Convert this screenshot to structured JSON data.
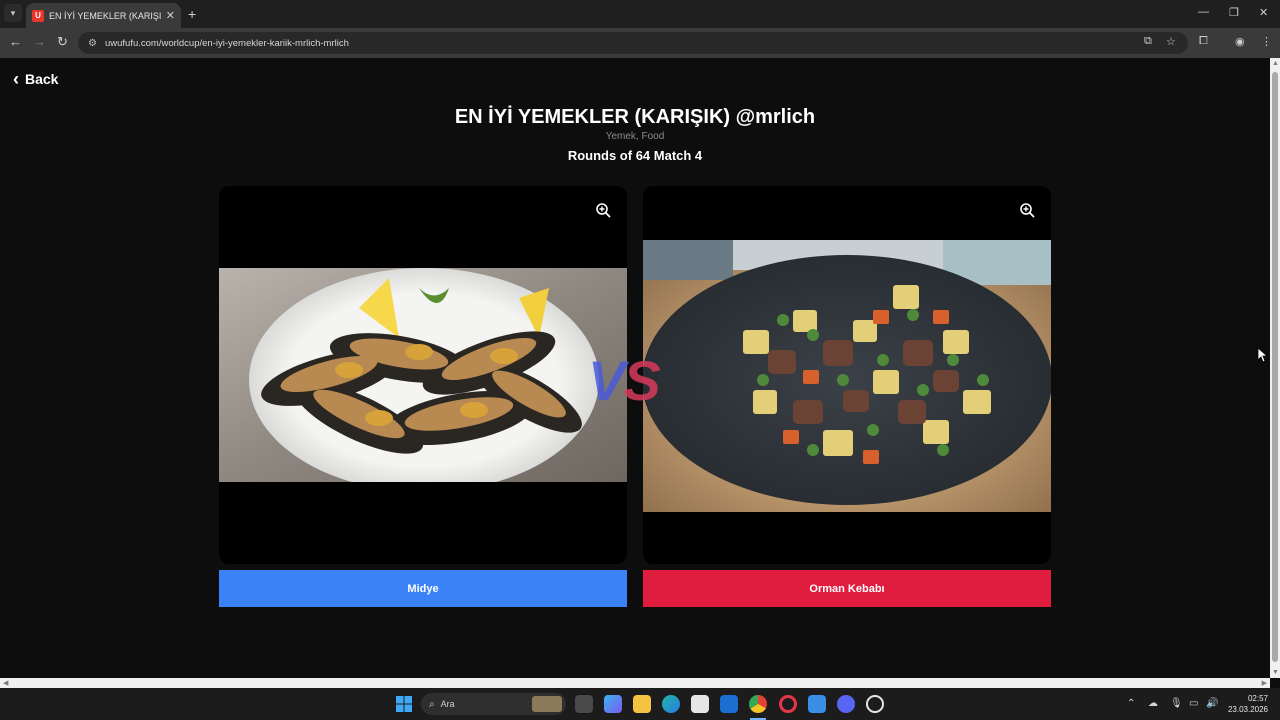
{
  "browser": {
    "tab_title": "EN İYİ YEMEKLER (KARIŞIK) @m",
    "favicon_letter": "U",
    "url": "uwufufu.com/worldcup/en-iyi-yemekler-kariik-mrlich-mrlich"
  },
  "page": {
    "back_label": "Back",
    "title": "EN İYİ YEMEKLER (KARIŞIK) @mrlich",
    "subtitle": "Yemek, Food",
    "round": "Rounds of 64 Match 4",
    "vs_v": "V",
    "vs_s": "S",
    "left_choice": "Midye",
    "right_choice": "Orman Kebabı",
    "left_color": "#3b82f6",
    "right_color": "#e11d3f"
  },
  "taskbar": {
    "search_placeholder": "Ara",
    "time": "02:57",
    "date": "23.03.2026"
  }
}
